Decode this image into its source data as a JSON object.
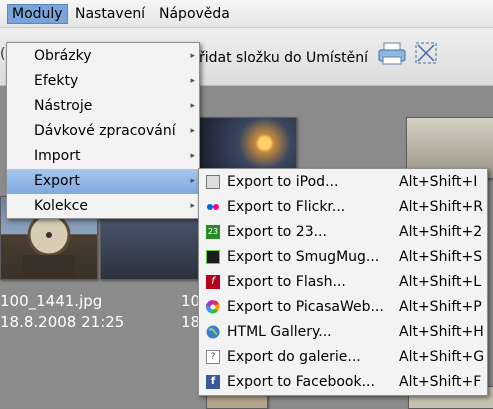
{
  "menubar": {
    "items": [
      {
        "label": "Moduly"
      },
      {
        "label": "Nastavení"
      },
      {
        "label": "Nápověda"
      }
    ]
  },
  "toolbar": {
    "left_stub": "(",
    "add_folder_text": "řidat složku do Umístění",
    "icons": [
      "print-icon",
      "fit-selection-icon"
    ]
  },
  "thumbnails": [
    {
      "filename": "100_1441.jpg",
      "date": "18.8.2008 21:25"
    },
    {
      "filename": "10",
      "date": "18."
    }
  ],
  "moduly_menu": {
    "items": [
      {
        "label": "Obrázky",
        "has_submenu": true
      },
      {
        "label": "Efekty",
        "has_submenu": true
      },
      {
        "label": "Nástroje",
        "has_submenu": true
      },
      {
        "label": "Dávkové zpracování",
        "has_submenu": true
      },
      {
        "label": "Import",
        "has_submenu": true
      },
      {
        "label": "Export",
        "has_submenu": true,
        "highlighted": true
      },
      {
        "label": "Kolekce",
        "has_submenu": true
      }
    ]
  },
  "export_menu": {
    "items": [
      {
        "label": "Export to iPod...",
        "accel": "Alt+Shift+I",
        "icon": "ipod-icon"
      },
      {
        "label": "Export to Flickr...",
        "accel": "Alt+Shift+R",
        "icon": "flickr-icon"
      },
      {
        "label": "Export to 23...",
        "accel": "Alt+Shift+2",
        "icon": "23hq-icon"
      },
      {
        "label": "Export to SmugMug...",
        "accel": "Alt+Shift+S",
        "icon": "smugmug-icon"
      },
      {
        "label": "Export to Flash...",
        "accel": "Alt+Shift+L",
        "icon": "flash-icon"
      },
      {
        "label": "Export to PicasaWeb...",
        "accel": "Alt+Shift+P",
        "icon": "picasa-icon"
      },
      {
        "label": "HTML Gallery...",
        "accel": "Alt+Shift+H",
        "icon": "globe-icon"
      },
      {
        "label": "Export do galerie...",
        "accel": "Alt+Shift+G",
        "icon": "gallery-icon"
      },
      {
        "label": "Export to Facebook...",
        "accel": "Alt+Shift+F",
        "icon": "facebook-icon"
      }
    ]
  },
  "colors": {
    "highlight": "#7fa9dd",
    "menu_bg": "#f3f3f3",
    "workspace_bg": "#8b8b8b"
  }
}
